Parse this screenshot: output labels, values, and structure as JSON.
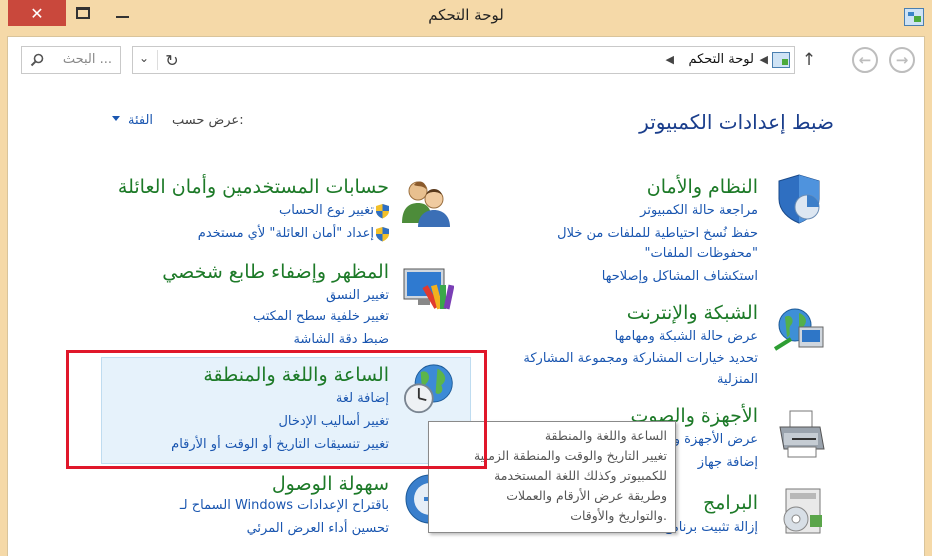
{
  "window": {
    "title": "لوحة التحكم",
    "close_label": "✕"
  },
  "nav": {
    "address_text": "لوحة التحكم",
    "search_placeholder": "البحث ..."
  },
  "header": {
    "heading": "ضبط إعدادات الكمبيوتر",
    "view_by_label": "عرض حسب:",
    "view_by_value": "الفئة"
  },
  "categories": {
    "system": {
      "title": "النظام والأمان",
      "links": [
        "مراجعة حالة الكمبيوتر",
        "حفظ نُسخ احتياطية للملفات من خلال",
        "\"محفوظات الملفات\"",
        "استكشاف المشاكل وإصلاحها"
      ]
    },
    "network": {
      "title": "الشبكة والإنترنت",
      "links": [
        "عرض حالة الشبكة ومهامها",
        "تحديد خيارات المشاركة ومجموعة المشاركة",
        "المنزلية"
      ]
    },
    "hardware": {
      "title": "الأجهزة والصوت",
      "links": [
        "عرض الأجهزة والطابعات",
        "إضافة جهاز"
      ]
    },
    "programs": {
      "title": "البرامج",
      "links": [
        "إزالة تثبيت برنامج"
      ]
    },
    "accounts": {
      "title": "حسابات المستخدمين وأمان العائلة",
      "links": [
        "تغيير نوع الحساب",
        "إعداد \"أمان العائلة\" لأي مستخدم"
      ]
    },
    "appearance": {
      "title": "المظهر وإضفاء طابع شخصي",
      "links": [
        "تغيير النسق",
        "تغيير خلفية سطح المكتب",
        "ضبط دقة الشاشة"
      ]
    },
    "clock": {
      "title": "الساعة واللغة والمنطقة",
      "links": [
        "إضافة لغة",
        "تغيير أساليب الإدخال",
        "تغيير تنسيقات التاريخ أو الوقت أو الأرقام"
      ]
    },
    "ease": {
      "title": "سهولة الوصول",
      "links": [
        "السماح لـ Windows باقتراح الإعدادات",
        "تحسين أداء العرض المرئي"
      ]
    }
  },
  "tooltip": {
    "lines": [
      "الساعة واللغة والمنطقة",
      "تغيير التاريخ والوقت والمنطقة الزمنية",
      "للكمبيوتر وكذلك اللغة المستخدمة",
      "وطريقة عرض الأرقام والعملات",
      "والتواريخ والأوقات."
    ]
  },
  "colors": {
    "title_bar": "#f5d9a8",
    "category_title": "#1d7a28",
    "link": "#1a56b0",
    "heading": "#1a3e8c",
    "annotation_frame": "#e0172a"
  }
}
